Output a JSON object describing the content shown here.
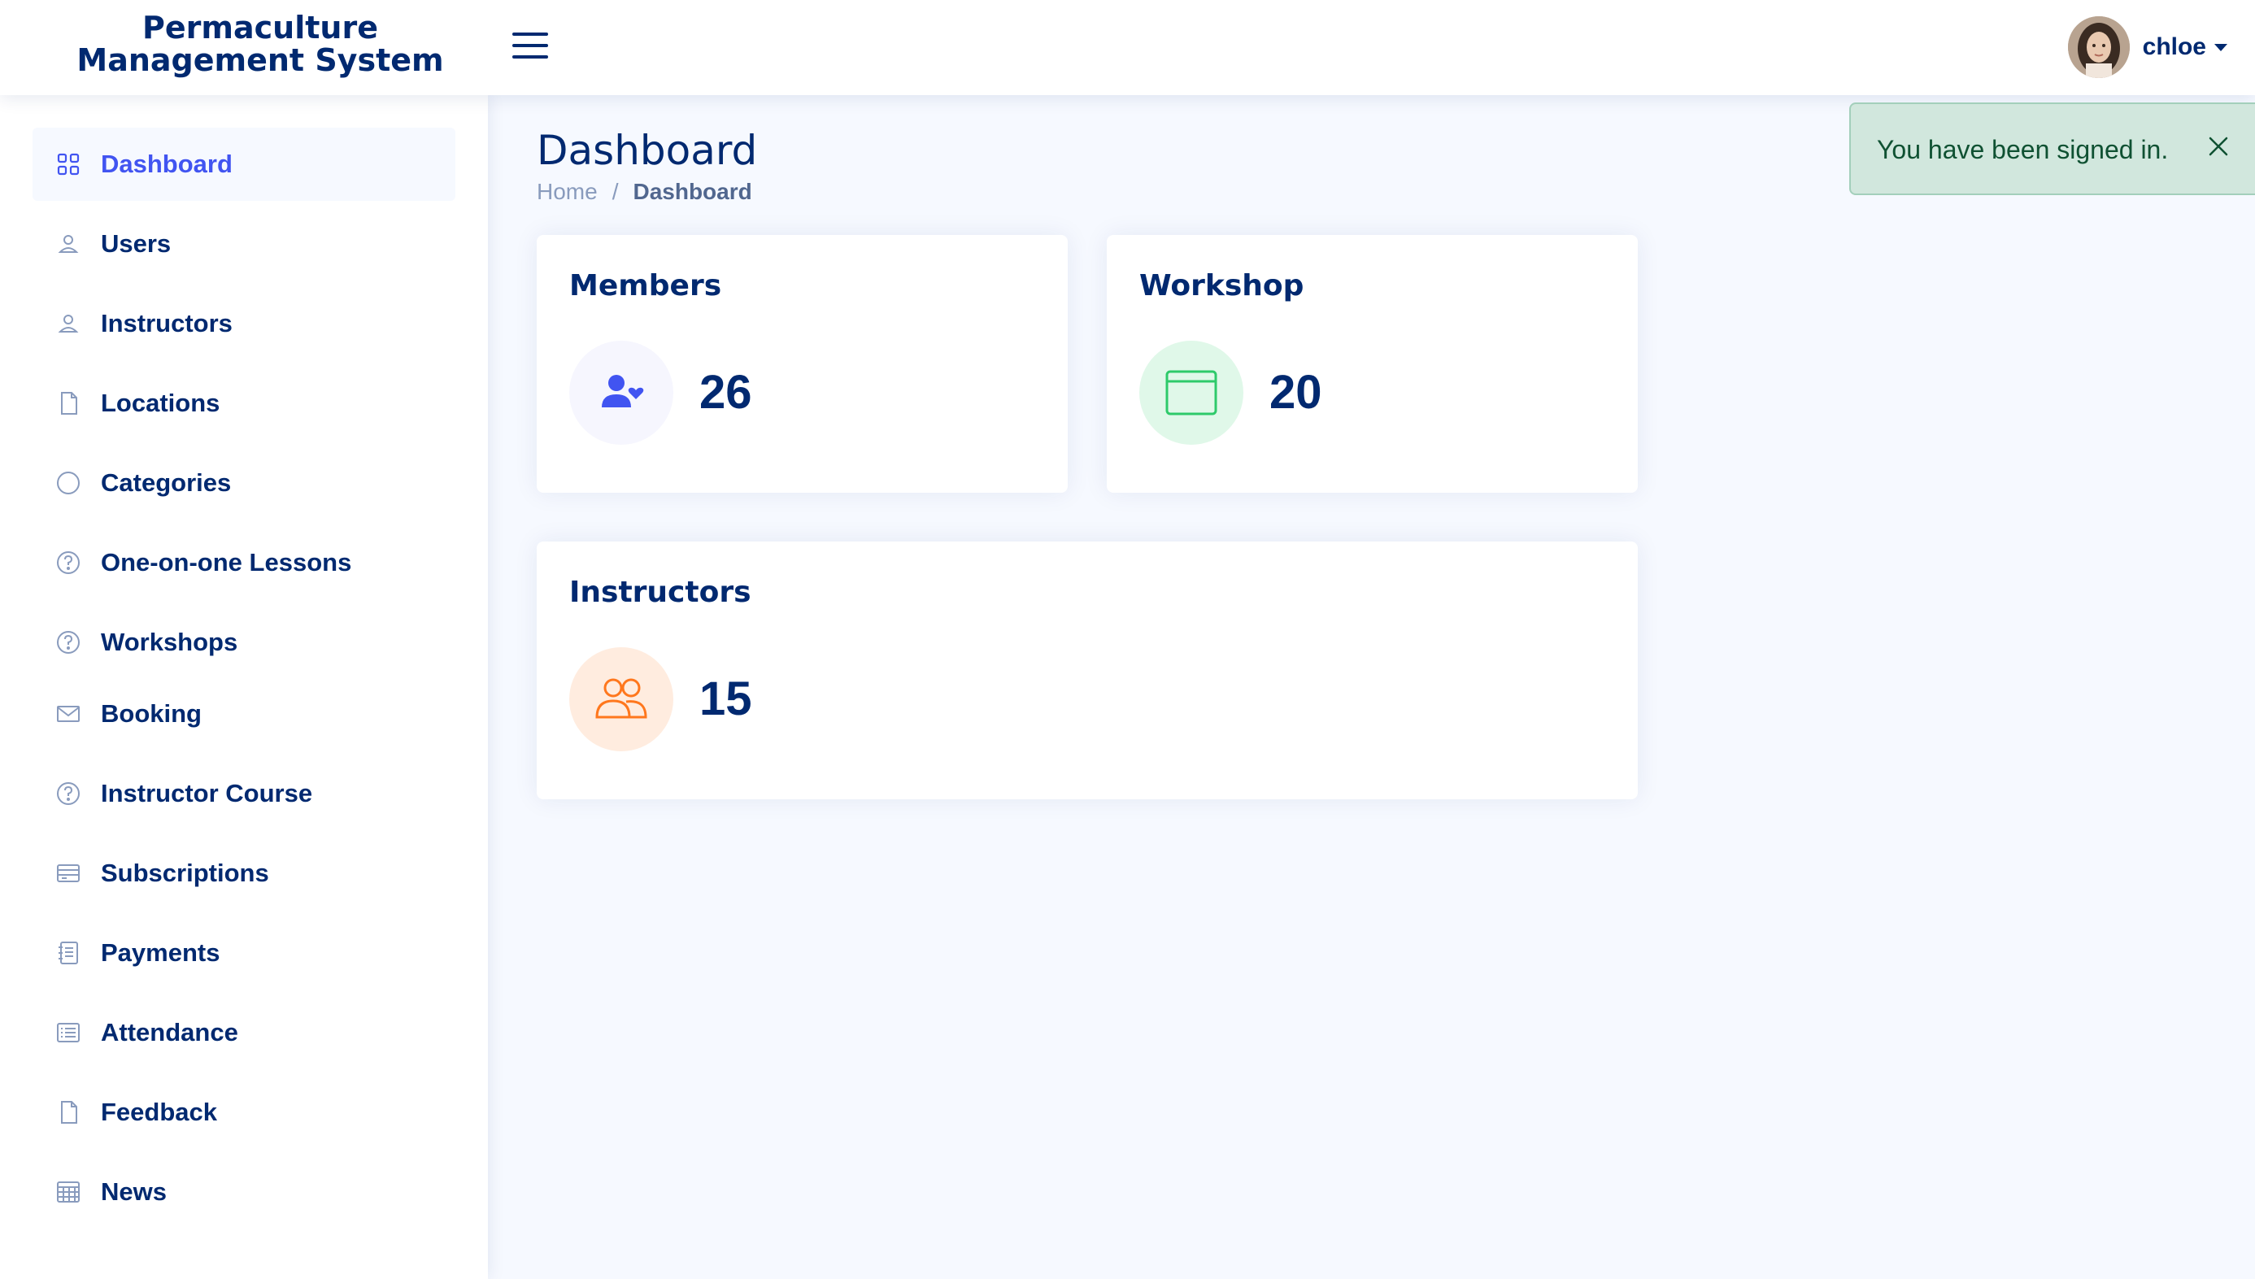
{
  "app": {
    "title": "Permaculture Management System"
  },
  "header": {
    "menu_icon": "hamburger-icon",
    "user": {
      "name": "chloe",
      "avatar": "user-avatar"
    }
  },
  "sidebar": {
    "items": [
      {
        "label": "Dashboard",
        "icon": "grid-icon",
        "active": true
      },
      {
        "label": "Users",
        "icon": "person-icon"
      },
      {
        "label": "Instructors",
        "icon": "person-icon"
      },
      {
        "label": "Locations",
        "icon": "file-icon"
      },
      {
        "label": "Categories",
        "icon": "circle-icon"
      },
      {
        "label": "One-on-one Lessons",
        "icon": "question-circle-icon"
      },
      {
        "label": "Workshops",
        "icon": "question-circle-icon"
      },
      {
        "label": "Booking",
        "icon": "envelope-icon"
      },
      {
        "label": "Instructor Course",
        "icon": "question-circle-icon"
      },
      {
        "label": "Subscriptions",
        "icon": "card-list-icon"
      },
      {
        "label": "Payments",
        "icon": "journal-icon"
      },
      {
        "label": "Attendance",
        "icon": "list-icon"
      },
      {
        "label": "Feedback",
        "icon": "file-icon"
      },
      {
        "label": "News",
        "icon": "calendar-grid-icon"
      }
    ]
  },
  "main": {
    "title": "Dashboard",
    "breadcrumb": {
      "home": "Home",
      "separator": "/",
      "current": "Dashboard"
    },
    "cards": {
      "members": {
        "title": "Members",
        "value": "26",
        "icon": "person-heart-icon",
        "icon_color": "#4154f1",
        "icon_bg": "#f6f6fe"
      },
      "workshop": {
        "title": "Workshop",
        "value": "20",
        "icon": "window-icon",
        "icon_color": "#2eca6a",
        "icon_bg": "#e0f8e9"
      },
      "instructors": {
        "title": "Instructors",
        "value": "15",
        "icon": "people-icon",
        "icon_color": "#ff771d",
        "icon_bg": "#ffecdf"
      }
    }
  },
  "toast": {
    "message": "You have been signed in.",
    "close_icon": "close-icon"
  },
  "colors": {
    "primary_text": "#012970",
    "accent": "#4154f1",
    "page_bg": "#f6f9ff",
    "toast_bg": "#d1e7dd",
    "toast_text": "#0f5132"
  }
}
